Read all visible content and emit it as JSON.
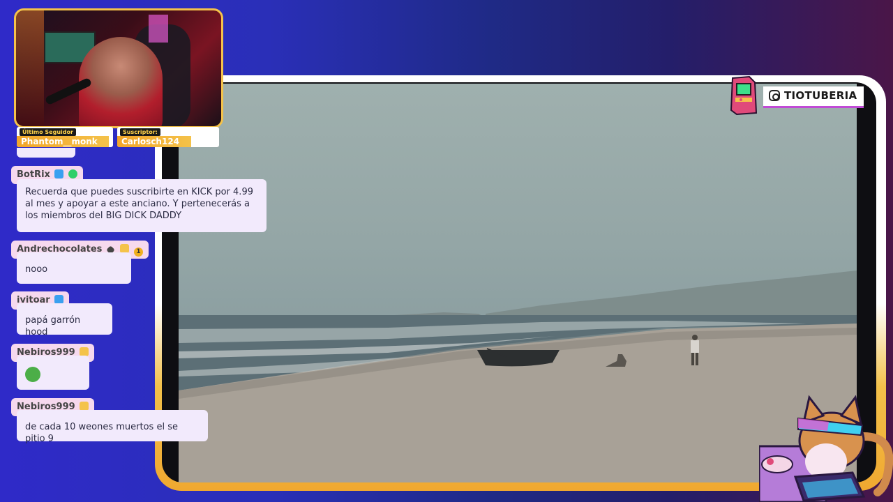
{
  "overlay": {
    "brand": {
      "icon": "instagram-icon",
      "handle": "TIOTUBERIA",
      "accent": "#c04ad6"
    },
    "alerts": {
      "last_follower": {
        "label": "Último Seguidor",
        "value": "Phantom__monk"
      },
      "subscriber": {
        "label": "Suscriptor:",
        "value": "Carlosch124"
      }
    }
  },
  "chat": {
    "messages": [
      {
        "user": "BotRix",
        "badges": [
          "blue-badge",
          "verified-badge"
        ],
        "text": "Recuerda que puedes suscribirte en KICK por 4.99 al mes y apoyar a este anciano. Y pertenecerás a los miembros del BIG DICK DADDY"
      },
      {
        "user": "Andrechocolates",
        "badges": [
          "diamond-badge",
          "crown-badge",
          "number-badge"
        ],
        "badge_number": "1",
        "text": "nooo"
      },
      {
        "user": "ivitoar",
        "badges": [
          "blue-badge"
        ],
        "text": "papá garrón hood"
      },
      {
        "user": "Nebiros999",
        "badges": [
          "crown-badge"
        ],
        "text": "",
        "emote": "pepe-emote"
      },
      {
        "user": "Nebiros999",
        "badges": [
          "crown-badge"
        ],
        "text": "de cada 10 weones muertos el se pitio 9"
      }
    ]
  }
}
